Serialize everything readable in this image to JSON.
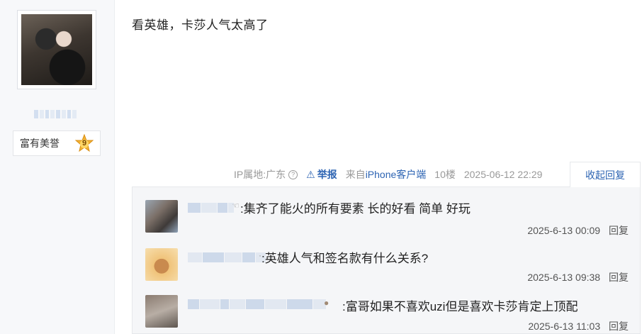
{
  "user": {
    "badge_label": "富有美誉",
    "level": "9"
  },
  "post": {
    "text": "看英雄，卡莎人气太高了",
    "ip": "IP属地:广东",
    "report": "举报",
    "from_prefix": "来自",
    "from_client": "iPhone客户端",
    "floor": "10楼",
    "time": "2025-06-12 22:29",
    "collapse_label": "收起回复"
  },
  "replies": [
    {
      "text": ":集齐了能火的所有要素 长的好看 简单 好玩",
      "time": "2025-6-13 00:09",
      "reply_label": "回复"
    },
    {
      "text": ":英雄人气和签名款有什么关系?",
      "time": "2025-6-13 09:38",
      "reply_label": "回复"
    },
    {
      "text": ":富哥如果不喜欢uzi但是喜欢卡莎肯定上顶配",
      "time": "2025-6-13 11:03",
      "reply_label": "回复"
    }
  ],
  "icons": {
    "star": "star-level-icon",
    "question": "question-circle-icon",
    "warning": "warning-triangle-icon"
  },
  "colors": {
    "link": "#2d64b3",
    "meta": "#999999",
    "panel": "#f5f6f8"
  }
}
